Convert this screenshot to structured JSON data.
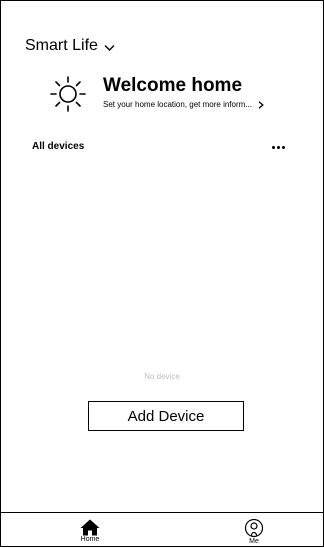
{
  "header": {
    "home_name": "Smart Life"
  },
  "welcome": {
    "title": "Welcome home",
    "subtitle": "Set your home location, get more inform..."
  },
  "devices": {
    "section_title": "All devices",
    "empty_text": "No device",
    "add_button_label": "Add Device"
  },
  "tabbar": {
    "tabs": [
      {
        "label": "Home",
        "icon": "home-icon"
      },
      {
        "label": "Me",
        "icon": "profile-icon"
      }
    ]
  }
}
